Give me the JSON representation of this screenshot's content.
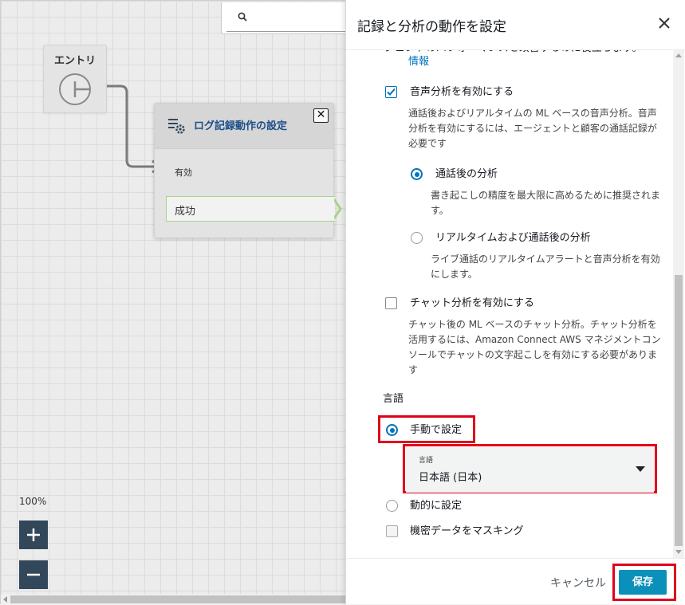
{
  "canvas": {
    "entry_label": "エントリ",
    "block": {
      "title": "ログ記録動作の設定",
      "close_label": "✕",
      "input_label": "有効",
      "branch_label": "成功"
    },
    "zoom_level": "100%",
    "zoom_in_label": "+",
    "zoom_out_label": "−"
  },
  "panel": {
    "title": "記録と分析の動作を設定",
    "truncated_text": "ジェントのパフォーマンスを改善するのに役立ちます。",
    "info_link": "情報",
    "voice_analytics": {
      "label": "音声分析を有効にする",
      "checked": true,
      "description": "通話後およびリアルタイムの ML ベースの音声分析。音声分析を有効にするには、エージェントと顧客の通話記録が必要です",
      "options": [
        {
          "label": "通話後の分析",
          "selected": true,
          "description": "書き起こしの精度を最大限に高めるために推奨されます。"
        },
        {
          "label": "リアルタイムおよび通話後の分析",
          "selected": false,
          "description": "ライブ通話のリアルタイムアラートと音声分析を有効にします。"
        }
      ]
    },
    "chat_analytics": {
      "label": "チャット分析を有効にする",
      "checked": false,
      "description": "チャット後の ML ベースのチャット分析。チャット分析を活用するには、Amazon Connect AWS マネジメントコンソールでチャットの文字起こしを有効にする必要があります"
    },
    "language": {
      "heading": "言語",
      "manual_label": "手動で設定",
      "manual_selected": true,
      "select_label": "言語",
      "select_value": "日本語 (日本)",
      "dynamic_label": "動的に設定",
      "dynamic_selected": false
    },
    "mask_sensitive": {
      "label": "機密データをマスキング",
      "checked": false
    },
    "footer": {
      "cancel_label": "キャンセル",
      "save_label": "保存"
    }
  },
  "colors": {
    "accent": "#0073bb",
    "primary_button": "#0a90b9",
    "highlight": "#e0001b",
    "zoom_button": "#33475b",
    "block_title": "#1d4e89"
  }
}
